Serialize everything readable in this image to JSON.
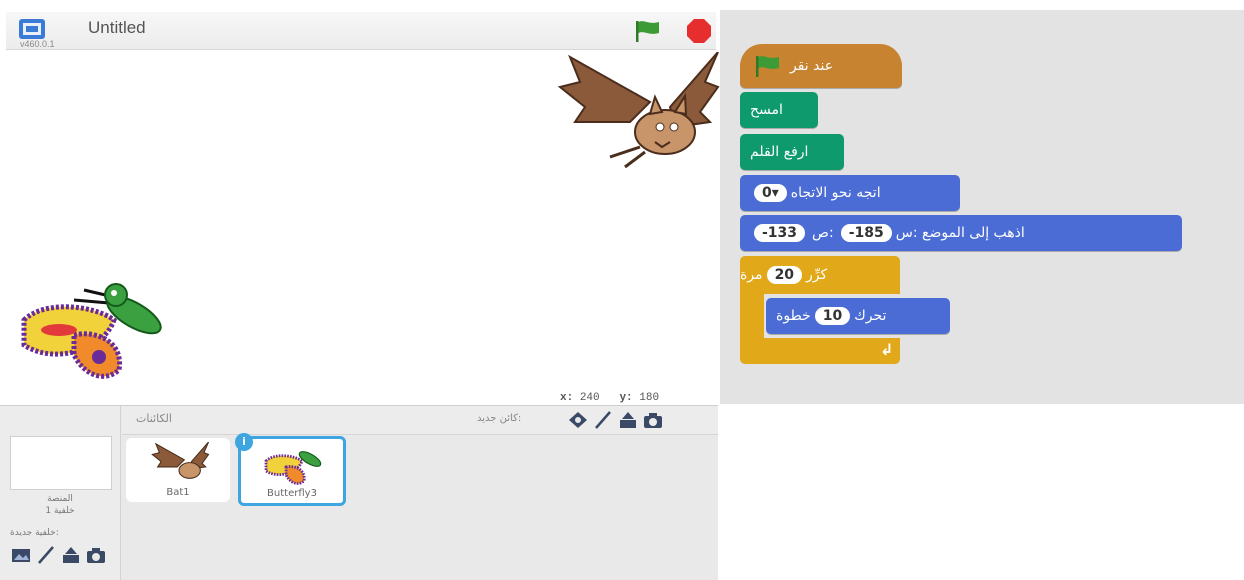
{
  "header": {
    "title": "Untitled",
    "version": "v460.0.1"
  },
  "stage": {
    "coords": {
      "x_label": "x:",
      "x_value": "240",
      "y_label": "y:",
      "y_value": "180"
    }
  },
  "sprite_pane": {
    "sprites_title": "الكائنات",
    "new_sprite_label": ":كائن جديد",
    "stage_label": "المنصة",
    "stage_backdrops": "خلفية 1",
    "new_backdrop_label": ":خلفية جديدة",
    "sprites": [
      {
        "name": "Bat1",
        "selected": false
      },
      {
        "name": "Butterfly3",
        "selected": true
      }
    ],
    "info_badge": "i"
  },
  "script": {
    "hat": {
      "text": "عند نقر"
    },
    "clear": {
      "text": "امسح"
    },
    "pen_up": {
      "text": "ارفع القلم"
    },
    "point_direction": {
      "text": "اتجه نحو الاتجاه",
      "value": "0▾"
    },
    "go_to": {
      "text": "اذهب إلى الموضع :س",
      "x": "-185",
      "y_label": ":ص",
      "y": "-133"
    },
    "repeat": {
      "text_before": "كرِّر",
      "count": "20",
      "text_after": "مرة"
    },
    "move": {
      "text_before": "تحرك",
      "steps": "10",
      "text_after": "خطوة"
    },
    "loop_arrow": "↲"
  },
  "colors": {
    "event": "#c88330",
    "pen": "#0e9a6c",
    "motion": "#4a6cd4",
    "control": "#e1a91a",
    "selection": "#3da5e0",
    "stop": "#e62e2e",
    "flag": "#3d9b35"
  },
  "icons": [
    "fullscreen-icon",
    "green-flag-icon",
    "stop-icon",
    "paint-icon",
    "brush-icon",
    "upload-icon",
    "camera-icon",
    "library-icon"
  ]
}
